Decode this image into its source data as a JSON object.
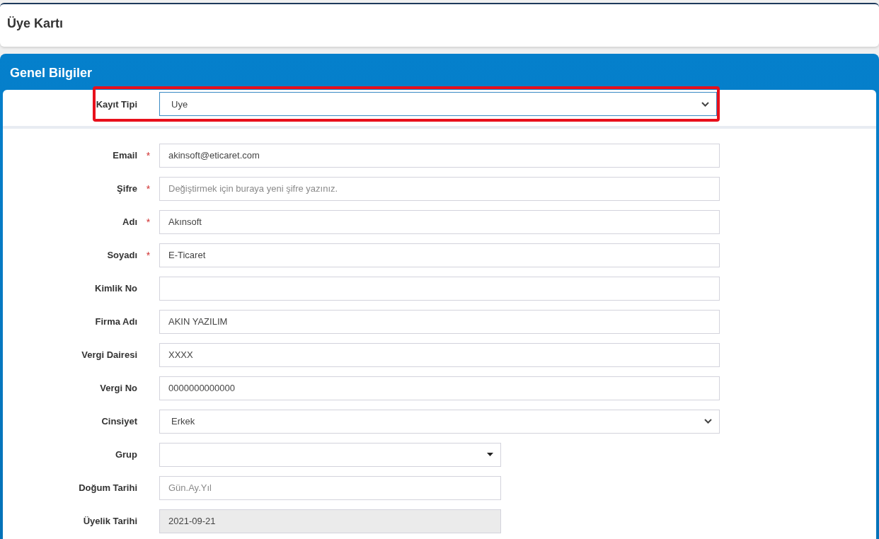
{
  "page_title": "Üye Kartı",
  "panel_title": "Genel Bilgiler",
  "required_mark": "*",
  "highlighted_field": {
    "label": "Kayıt Tipi",
    "kind": "select",
    "value": "Uye",
    "highlighted": true
  },
  "fields": [
    {
      "label": "Email",
      "required": true,
      "kind": "text",
      "value": "akinsoft@eticaret.com",
      "wide": true
    },
    {
      "label": "Şifre",
      "required": true,
      "kind": "text",
      "placeholder": "Değiştirmek için buraya yeni şifre yazınız.",
      "wide": true
    },
    {
      "label": "Adı",
      "required": true,
      "kind": "text",
      "value": "Akınsoft",
      "wide": true
    },
    {
      "label": "Soyadı",
      "required": true,
      "kind": "text",
      "value": "E-Ticaret",
      "wide": true
    },
    {
      "label": "Kimlik No",
      "required": false,
      "kind": "text",
      "wide": true
    },
    {
      "label": "Firma Adı",
      "required": false,
      "kind": "text",
      "value": "AKIN YAZILIM",
      "wide": true
    },
    {
      "label": "Vergi Dairesi",
      "required": false,
      "kind": "text",
      "value": "XXXX",
      "wide": true
    },
    {
      "label": "Vergi No",
      "required": false,
      "kind": "text",
      "value": "0000000000000",
      "wide": true
    },
    {
      "label": "Cinsiyet",
      "required": false,
      "kind": "select",
      "value": "Erkek",
      "wide": true
    },
    {
      "label": "Grup",
      "required": false,
      "kind": "dropdown",
      "wide": false
    },
    {
      "label": "Doğum Tarihi",
      "required": false,
      "kind": "text",
      "placeholder": "Gün.Ay.Yıl",
      "wide": false
    },
    {
      "label": "Üyelik Tarihi",
      "required": false,
      "kind": "text",
      "value": "2021-09-21",
      "wide": false,
      "disabled": true
    }
  ]
}
